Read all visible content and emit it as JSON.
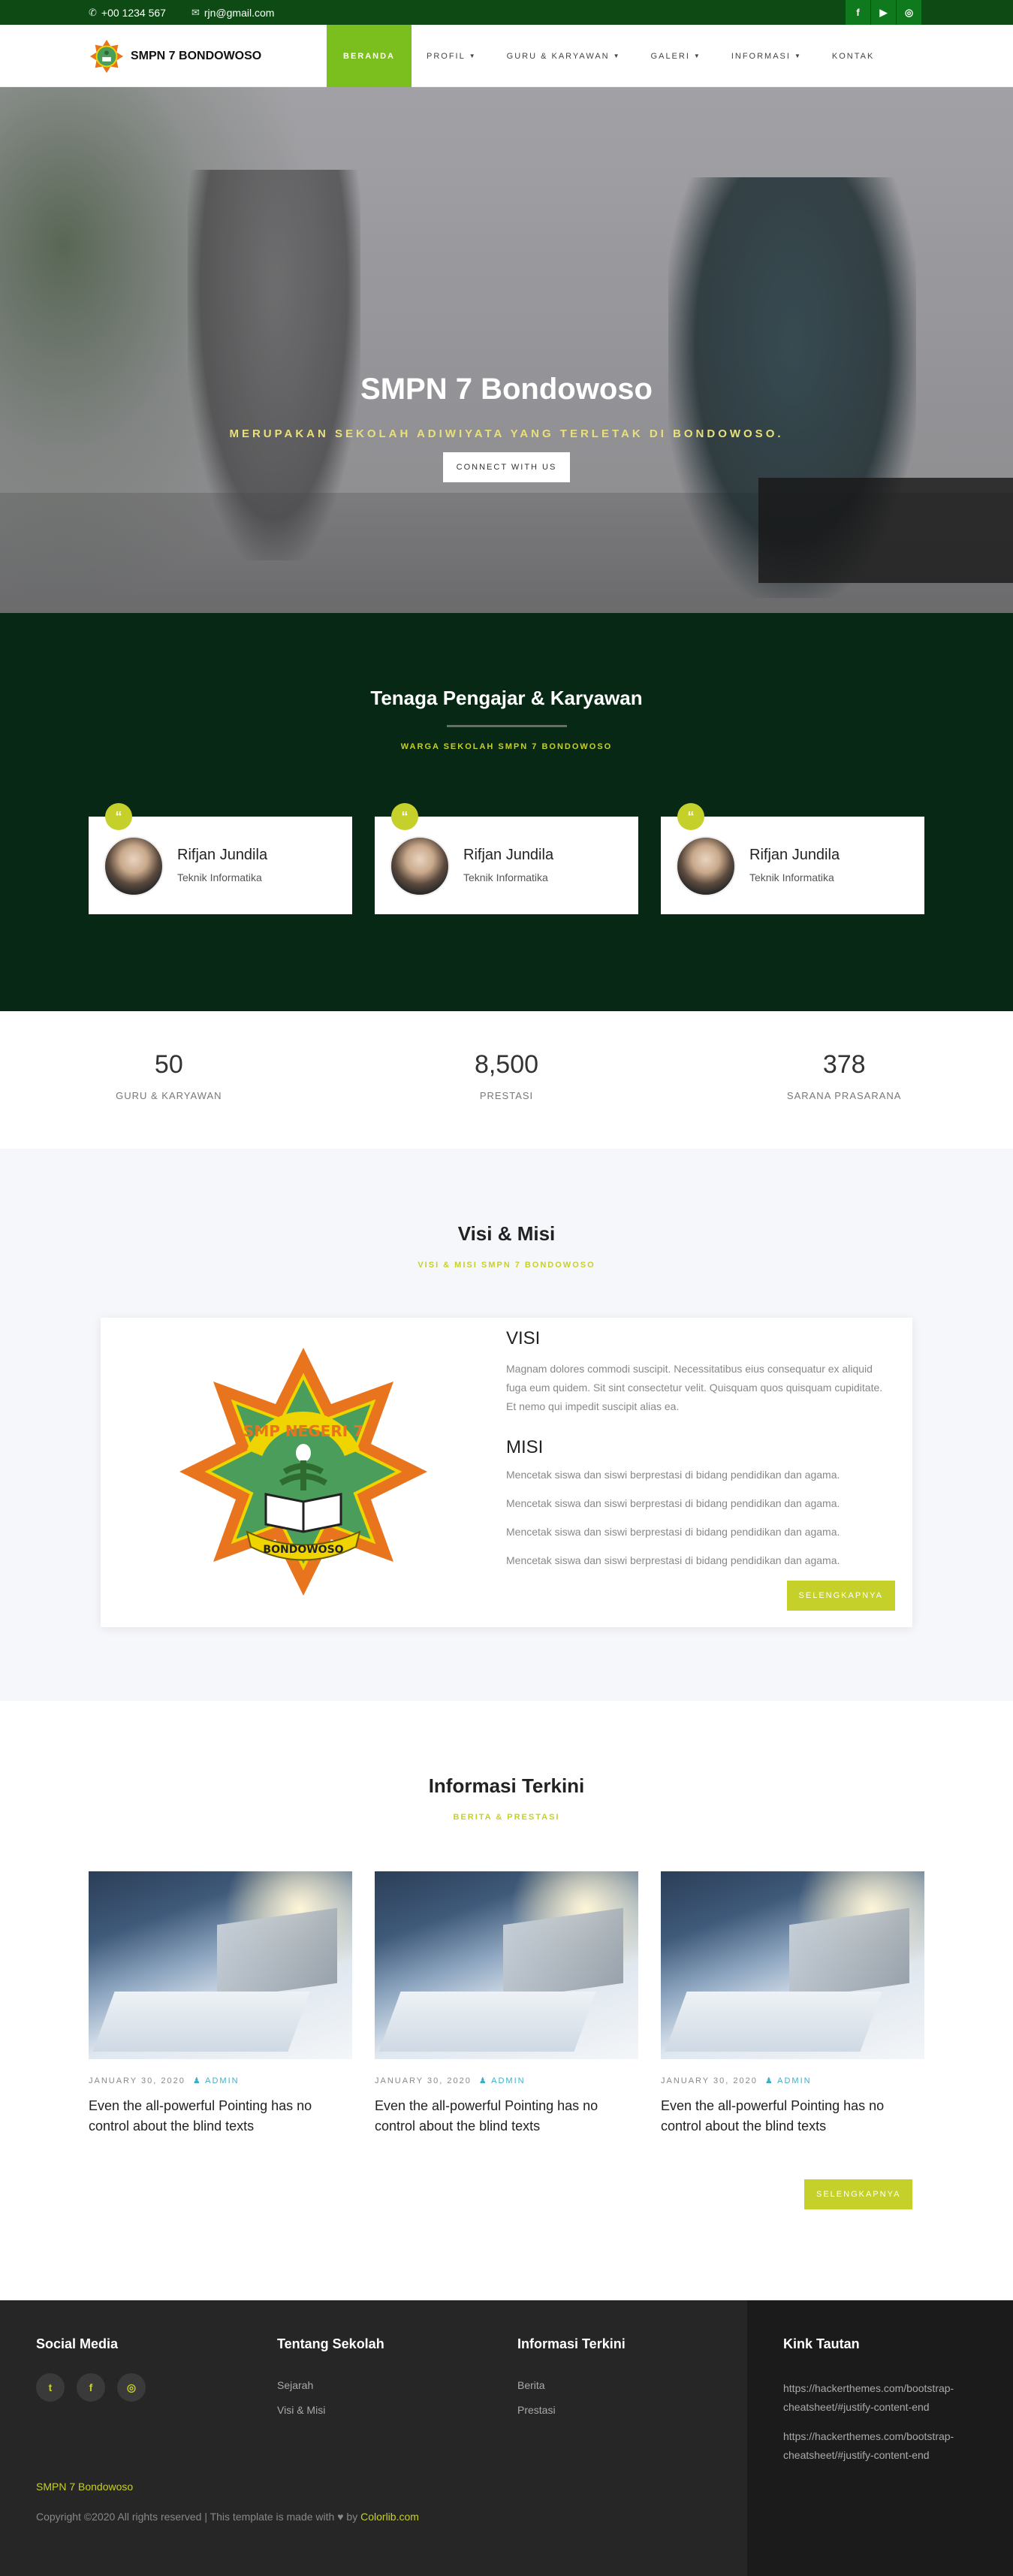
{
  "topbar": {
    "phone": "+00 1234 567",
    "email": "rjn@gmail.com",
    "social": [
      "f",
      "▶",
      "◎"
    ]
  },
  "navbar": {
    "brand": "SMPN 7 BONDOWOSO",
    "items": [
      {
        "label": "BERANDA",
        "dropdown": false,
        "active": true
      },
      {
        "label": "PROFIL",
        "dropdown": true,
        "active": false
      },
      {
        "label": "GURU & KARYAWAN",
        "dropdown": true,
        "active": false
      },
      {
        "label": "GALERI",
        "dropdown": true,
        "active": false
      },
      {
        "label": "INFORMASI",
        "dropdown": true,
        "active": false
      },
      {
        "label": "KONTAK",
        "dropdown": false,
        "active": false
      }
    ]
  },
  "hero": {
    "title": "SMPN 7 Bondowoso",
    "subtitle": "MERUPAKAN SEKOLAH ADIWIYATA YANG TERLETAK DI BONDOWOSO.",
    "button": "CONNECT WITH US"
  },
  "staff": {
    "title": "Tenaga Pengajar & Karyawan",
    "subtitle": "WARGA SEKOLAH SMPN 7 BONDOWOSO",
    "cards": [
      {
        "name": "Rifjan Jundila",
        "role": "Teknik Informatika"
      },
      {
        "name": "Rifjan Jundila",
        "role": "Teknik Informatika"
      },
      {
        "name": "Rifjan Jundila",
        "role": "Teknik Informatika"
      }
    ]
  },
  "counters": [
    {
      "value": "50",
      "label": "GURU & KARYAWAN"
    },
    {
      "value": "8,500",
      "label": "PRESTASI"
    },
    {
      "value": "378",
      "label": "SARANA PRASARANA"
    }
  ],
  "visi_misi": {
    "title": "Visi & Misi",
    "subtitle": "VISI & MISI SMPN 7 BONDOWOSO",
    "emblem_text_top": "SMP NEGERI 7",
    "emblem_text_bottom": "BONDOWOSO",
    "visi_heading": "VISI",
    "visi_text": "Magnam dolores commodi suscipit. Necessitatibus eius consequatur ex aliquid fuga eum quidem. Sit sint consectetur velit. Quisquam quos quisquam cupiditate. Et nemo qui impedit suscipit alias ea.",
    "misi_heading": "MISI",
    "misi_items": [
      "Mencetak siswa dan siswi berprestasi di bidang pendidikan dan agama.",
      "Mencetak siswa dan siswi berprestasi di bidang pendidikan dan agama.",
      "Mencetak siswa dan siswi berprestasi di bidang pendidikan dan agama.",
      "Mencetak siswa dan siswi berprestasi di bidang pendidikan dan agama."
    ],
    "button": "SELENGKAPNYA"
  },
  "news": {
    "title": "Informasi Terkini",
    "subtitle": "BERITA & PRESTASI",
    "cards": [
      {
        "date": "JANUARY 30, 2020",
        "author": "ADMIN",
        "title": "Even the all-powerful Pointing has no control about the blind texts"
      },
      {
        "date": "JANUARY 30, 2020",
        "author": "ADMIN",
        "title": "Even the all-powerful Pointing has no control about the blind texts"
      },
      {
        "date": "JANUARY 30, 2020",
        "author": "ADMIN",
        "title": "Even the all-powerful Pointing has no control about the blind texts"
      }
    ],
    "button": "SELENGKAPNYA"
  },
  "footer": {
    "social_title": "Social Media",
    "social_icons": [
      "t",
      "f",
      "◎"
    ],
    "about_title": "Tentang Sekolah",
    "about_links": [
      "Sejarah",
      "Visi & Misi"
    ],
    "info_title": "Informasi Terkini",
    "info_links": [
      "Berita",
      "Prestasi"
    ],
    "links_title": "Kink Tautan",
    "links": [
      "https://hackerthemes.com/bootstrap-cheatsheet/#justify-content-end",
      "https://hackerthemes.com/bootstrap-cheatsheet/#justify-content-end"
    ],
    "brand": "SMPN 7 Bondowoso",
    "copy_prefix": "Copyright ©2020 All rights reserved | This template is made with",
    "copy_by": "by",
    "copy_link": "Colorlib.com"
  },
  "colors": {
    "topbar": "#0d4a14",
    "nav_active": "#7bbf1e",
    "accent": "#c6d02a",
    "staff_bg": "#062814",
    "footer_bg": "#262626"
  }
}
